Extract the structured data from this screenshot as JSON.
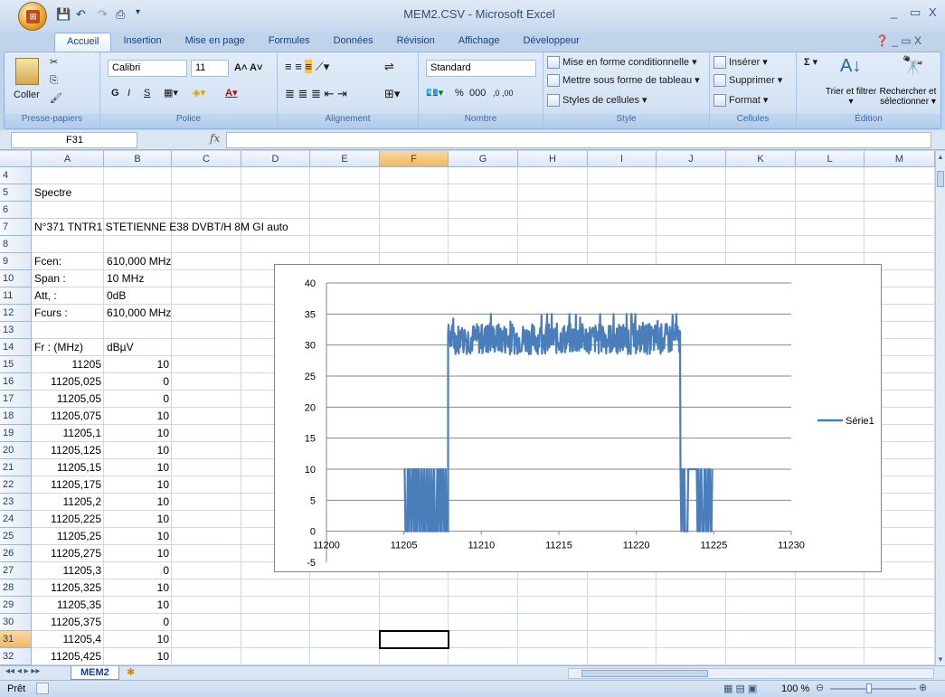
{
  "window": {
    "title": "MEM2.CSV - Microsoft Excel",
    "controls": [
      "_",
      "▭",
      "X"
    ]
  },
  "ribbon": {
    "tabs": [
      "Accueil",
      "Insertion",
      "Mise en page",
      "Formules",
      "Données",
      "Révision",
      "Affichage",
      "Développeur"
    ],
    "groups": {
      "clipboard": {
        "label": "Presse-papiers",
        "paste": "Coller"
      },
      "font": {
        "label": "Police",
        "font_name": "Calibri",
        "font_size": "11",
        "bold": "G",
        "italic": "I",
        "underline": "S"
      },
      "alignment": {
        "label": "Alignement"
      },
      "number": {
        "label": "Nombre",
        "format": "Standard",
        "percent": "%",
        "thousands": "000",
        "inc_dec": ",0 ,00"
      },
      "style": {
        "label": "Style",
        "conditional": "Mise en forme conditionnelle ▾",
        "table": "Mettre sous forme de tableau ▾",
        "cell_styles": "Styles de cellules ▾"
      },
      "cells": {
        "label": "Cellules",
        "insert": "Insérer ▾",
        "delete": "Supprimer ▾",
        "format": "Format ▾"
      },
      "editing": {
        "label": "Édition",
        "sort": "Trier et filtrer ▾",
        "find": "Rechercher et sélectionner ▾",
        "sigma": "Σ ▾"
      }
    }
  },
  "formula_bar": {
    "name_box": "F31",
    "fx": "fx",
    "value": ""
  },
  "columns": [
    "A",
    "B",
    "C",
    "D",
    "E",
    "F",
    "G",
    "H",
    "I",
    "J",
    "K",
    "L",
    "M"
  ],
  "rows": [
    {
      "n": "4",
      "a": "",
      "b": ""
    },
    {
      "n": "5",
      "a": "Spectre",
      "b": ""
    },
    {
      "n": "6",
      "a": "",
      "b": ""
    },
    {
      "n": "7",
      "a": "N°371 TNTR1 STETIENNE E38 DVBT/H 8M GI auto",
      "b": ""
    },
    {
      "n": "8",
      "a": "",
      "b": ""
    },
    {
      "n": "9",
      "a": "Fcen:",
      "b": "610,000 MHz"
    },
    {
      "n": "10",
      "a": "Span :",
      "b": "10 MHz"
    },
    {
      "n": "11",
      "a": "Att, :",
      "b": "0dB"
    },
    {
      "n": "12",
      "a": "Fcurs :",
      "b": "610,000 MHz"
    },
    {
      "n": "13",
      "a": "",
      "b": ""
    },
    {
      "n": "14",
      "a": "Fr : (MHz)",
      "b": "dBµV"
    },
    {
      "n": "15",
      "a": "11205",
      "b": "10"
    },
    {
      "n": "16",
      "a": "11205,025",
      "b": "0"
    },
    {
      "n": "17",
      "a": "11205,05",
      "b": "0"
    },
    {
      "n": "18",
      "a": "11205,075",
      "b": "10"
    },
    {
      "n": "19",
      "a": "11205,1",
      "b": "10"
    },
    {
      "n": "20",
      "a": "11205,125",
      "b": "10"
    },
    {
      "n": "21",
      "a": "11205,15",
      "b": "10"
    },
    {
      "n": "22",
      "a": "11205,175",
      "b": "10"
    },
    {
      "n": "23",
      "a": "11205,2",
      "b": "10"
    },
    {
      "n": "24",
      "a": "11205,225",
      "b": "10"
    },
    {
      "n": "25",
      "a": "11205,25",
      "b": "10"
    },
    {
      "n": "26",
      "a": "11205,275",
      "b": "10"
    },
    {
      "n": "27",
      "a": "11205,3",
      "b": "0"
    },
    {
      "n": "28",
      "a": "11205,325",
      "b": "10"
    },
    {
      "n": "29",
      "a": "11205,35",
      "b": "10"
    },
    {
      "n": "30",
      "a": "11205,375",
      "b": "0"
    },
    {
      "n": "31",
      "a": "11205,4",
      "b": "10"
    },
    {
      "n": "32",
      "a": "11205,425",
      "b": "10"
    }
  ],
  "active_cell": "F31",
  "chart_data": {
    "type": "line",
    "title": "",
    "xlabel": "",
    "ylabel": "",
    "xlim": [
      11200,
      11230
    ],
    "ylim": [
      -5,
      40
    ],
    "xticks": [
      "11200",
      "11205",
      "11210",
      "11215",
      "11220",
      "11225",
      "11230"
    ],
    "yticks": [
      "-5",
      "0",
      "5",
      "10",
      "15",
      "20",
      "25",
      "30",
      "35",
      "40"
    ],
    "legend": "right",
    "series": [
      {
        "name": "Série1",
        "color": "#4a7ebb",
        "segments": [
          {
            "from": 11205,
            "to": 11207.85,
            "pattern": "toggle",
            "levels": [
              0,
              10
            ]
          },
          {
            "from": 11207.85,
            "to": 11222.85,
            "pattern": "noise",
            "mean": 31,
            "min": 28,
            "max": 35
          },
          {
            "from": 11222.85,
            "to": 11224.9,
            "pattern": "toggle",
            "levels": [
              0,
              10
            ]
          }
        ]
      }
    ]
  },
  "sheets": [
    "MEM2"
  ],
  "status": {
    "ready": "Prêt",
    "zoom": "100 %"
  }
}
